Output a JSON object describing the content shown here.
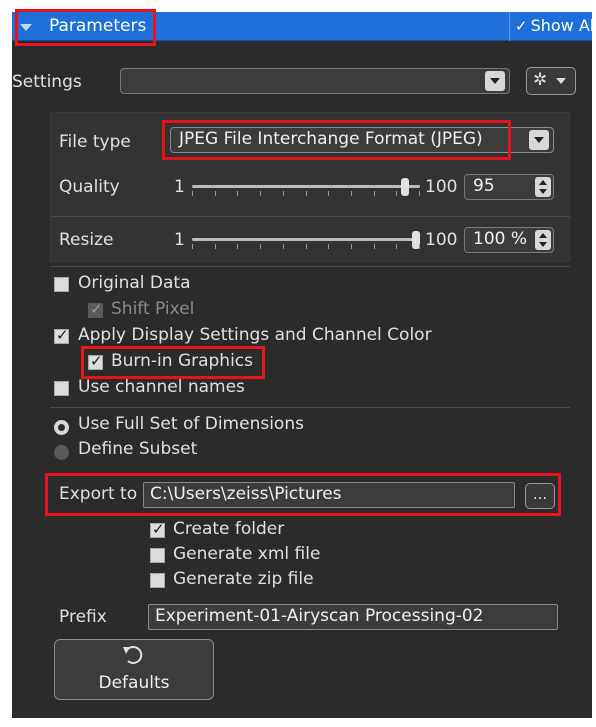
{
  "header": {
    "title": "Parameters",
    "show_all": "Show All",
    "show_all_check": "✓"
  },
  "settings": {
    "label": "Settings",
    "value": ""
  },
  "file_type": {
    "label": "File type",
    "value": "JPEG File Interchange Format (JPEG)"
  },
  "quality": {
    "label": "Quality",
    "min": "1",
    "max": "100",
    "value": "95",
    "fraction": 0.95
  },
  "resize": {
    "label": "Resize",
    "min": "1",
    "max": "100",
    "value": "100 %",
    "fraction": 1.0
  },
  "options": {
    "original_data": "Original Data",
    "shift_pixel": "Shift Pixel",
    "apply_display": "Apply Display Settings and Channel Color",
    "burn_in": "Burn-in Graphics",
    "channel_names": "Use channel names"
  },
  "dimensions": {
    "full_set": "Use Full Set of Dimensions",
    "subset": "Define Subset"
  },
  "export": {
    "label": "Export to",
    "path": "C:\\Users\\zeiss\\Pictures",
    "browse": "...",
    "create_folder": "Create folder",
    "gen_xml": "Generate xml file",
    "gen_zip": "Generate zip file"
  },
  "prefix": {
    "label": "Prefix",
    "value": "Experiment-01-Airyscan Processing-02"
  },
  "defaults": {
    "label": "Defaults"
  },
  "colors": {
    "header_blue": "#1e6fd9",
    "panel_bg": "#2b2b2b",
    "highlight_red": "#e8131b"
  }
}
